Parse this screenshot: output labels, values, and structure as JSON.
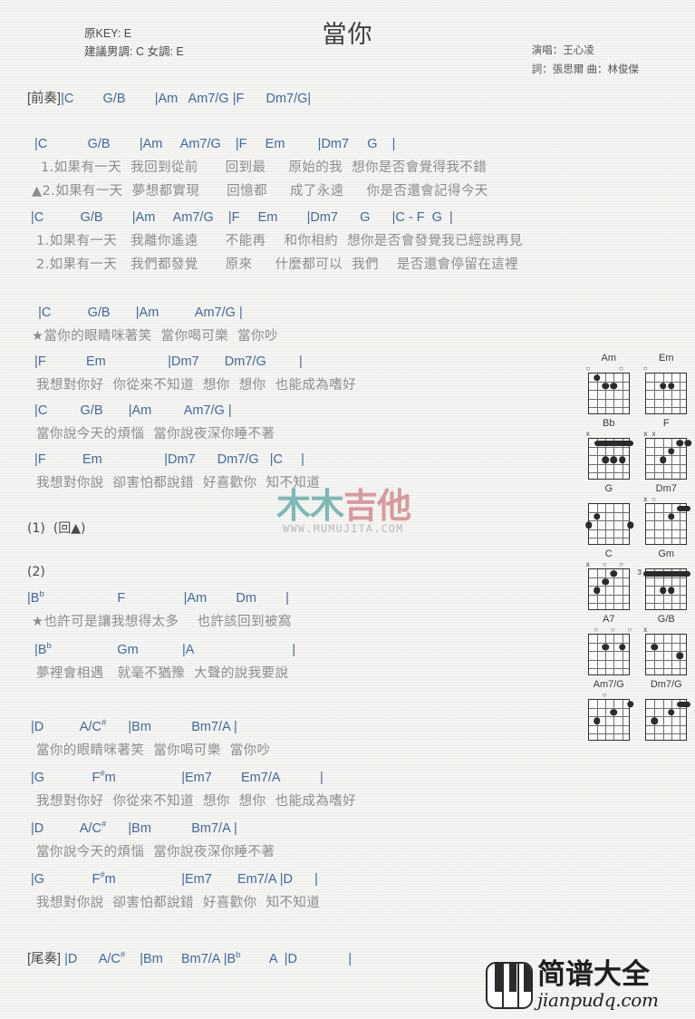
{
  "header": {
    "title": "當你",
    "orig_key": "原KEY: E",
    "suggest_key": "建議男調: C 女調: E",
    "singer": "演唱：王心凌",
    "writer": "詞：張思爾  曲：林俊傑"
  },
  "intro": {
    "tag": "[前奏]",
    "chords": "|C        G/B        |Am   Am7/G |F      Dm7/G|"
  },
  "verse1": {
    "chord_line_1": "  |C           G/B        |Am     Am7/G    |F     Em         |Dm7     G    |",
    "lyric_1": "   1.如果有一天  我回到從前      回到最     原始的我  想你是否會覺得我不錯",
    "lyric_2": " ▲2.如果有一天  夢想都實現      回憶都     成了永遠     你是否還會記得今天",
    "chord_line_2": " |C          G/B        |Am     Am7/G    |F     Em        |Dm7      G      |C - F  G  |",
    "lyric_3": "  1.如果有一天   我離你遙遠      不能再    和你相約  想你是否會發覺我已經說再見",
    "lyric_4": "  2.如果有一天   我們都發覺      原來     什麼都可以  我們    是否還會停留在這裡"
  },
  "chorus_c": {
    "chord_line_1": "   |C          G/B       |Am          Am7/G |",
    "lyric_1": " ★當你的眼睛咪著笑  當你喝可樂  當你吵",
    "chord_line_2": "  |F           Em                 |Dm7       Dm7/G         |",
    "lyric_2": "  我想對你好  你從來不知道  想你  想你  也能成為嗜好",
    "chord_line_3": "  |C         G/B       |Am         Am7/G |",
    "lyric_3": "  當你說今天的煩惱  當你說夜深你睡不著",
    "chord_line_4": "  |F          Em                 |Dm7      Dm7/G   |C     |",
    "lyric_4": "  我想對你說  卻害怕都說錯  好喜歡你  知不知道"
  },
  "section_1": {
    "label": "(1)  (回▲)"
  },
  "section_2": {
    "label": "(2)"
  },
  "bridge": {
    "chord_line_1_a": "|B",
    "chord_line_1_sup": "b",
    "chord_line_1_b": "                    F                |Am        Dm        |",
    "lyric_1": " ★也許可是讓我想得太多    也許該回到被窩",
    "chord_line_2_a": "  |B",
    "chord_line_2_sup": "b",
    "chord_line_2_b": "                  Gm            |A                           |",
    "lyric_2": "  夢裡會相遇   就毫不猶豫  大聲的說我要說"
  },
  "chorus_d": {
    "c1_a": " |D          A/C",
    "c1_sup": "#",
    "c1_b": "      |Bm           Bm7/A |",
    "l1": "  當你的眼睛咪著笑  當你喝可樂  當你吵",
    "c2_a": " |G             F",
    "c2_sup": "#",
    "c2_b": "m                  |Em7        Em7/A           |",
    "l2": "  我想對你好  你從來不知道  想你  想你  也能成為嗜好",
    "c3_a": " |D          A/C",
    "c3_sup": "#",
    "c3_b": "      |Bm           Bm7/A |",
    "l3": "  當你說今天的煩惱  當你說夜深你睡不著",
    "c4_a": " |G             F",
    "c4_sup": "#",
    "c4_b": "m                  |Em7       Em7/A |D      |",
    "l4": "  我想對你說  卻害怕都說錯  好喜歡你  知不知道"
  },
  "outro": {
    "tag": "[尾奏]",
    "c_a": " |D      A/C",
    "c_sup": "#",
    "c_b": "    |Bm     Bm7/A |B",
    "c_sup2": "b",
    "c_c": "        A  |D              |"
  },
  "watermark_mumujita": {
    "logo_part1": "木木",
    "logo_part2": "吉他",
    "url": "WWW.MUMUJITA.COM",
    "color1": "#7fb7b5",
    "color2": "#d79a9c"
  },
  "logo_jianpudq": {
    "cn": "简谱大全",
    "en": "jianpudq.com"
  },
  "chord_diagrams": [
    {
      "name": "Am",
      "markers": [
        {
          "sym": "o",
          "string": 1
        },
        {
          "sym": "o",
          "string": 5
        }
      ],
      "dots": [
        {
          "s": 2,
          "f": 1
        },
        {
          "s": 3,
          "f": 2
        },
        {
          "s": 4,
          "f": 2
        }
      ],
      "barre": null,
      "fret_label": ""
    },
    {
      "name": "Em",
      "markers": [
        {
          "sym": "o",
          "string": 1
        }
      ],
      "dots": [
        {
          "s": 3,
          "f": 2
        },
        {
          "s": 4,
          "f": 2
        }
      ],
      "barre": null,
      "fret_label": ""
    },
    {
      "name": "Bb",
      "markers": [
        {
          "sym": "x",
          "string": 1
        }
      ],
      "dots": [
        {
          "s": 3,
          "f": 3
        },
        {
          "s": 4,
          "f": 3
        },
        {
          "s": 5,
          "f": 3
        }
      ],
      "barre": {
        "f": 1,
        "from": 2,
        "to": 6
      },
      "fret_label": ""
    },
    {
      "name": "F",
      "markers": [
        {
          "sym": "x",
          "string": 1
        },
        {
          "sym": "x",
          "string": 2
        }
      ],
      "dots": [
        {
          "s": 3,
          "f": 3
        },
        {
          "s": 4,
          "f": 2
        },
        {
          "s": 5,
          "f": 1
        },
        {
          "s": 6,
          "f": 1
        }
      ],
      "barre": null,
      "fret_label": ""
    },
    {
      "name": "G",
      "markers": [],
      "dots": [
        {
          "s": 1,
          "f": 3
        },
        {
          "s": 2,
          "f": 2
        },
        {
          "s": 6,
          "f": 3
        }
      ],
      "barre": null,
      "fret_label": ""
    },
    {
      "name": "Dm7",
      "markers": [
        {
          "sym": "x",
          "string": 1
        },
        {
          "sym": "o",
          "string": 2
        }
      ],
      "dots": [
        {
          "s": 4,
          "f": 2
        }
      ],
      "barre": {
        "f": 1,
        "from": 5,
        "to": 6
      },
      "fret_label": ""
    },
    {
      "name": "C",
      "markers": [
        {
          "sym": "x",
          "string": 1
        },
        {
          "sym": "o",
          "string": 3
        },
        {
          "sym": "o",
          "string": 5
        }
      ],
      "dots": [
        {
          "s": 2,
          "f": 3
        },
        {
          "s": 3,
          "f": 2
        },
        {
          "s": 4,
          "f": 1
        }
      ],
      "barre": null,
      "fret_label": ""
    },
    {
      "name": "Gm",
      "markers": [],
      "dots": [
        {
          "s": 3,
          "f": 3
        },
        {
          "s": 4,
          "f": 3
        }
      ],
      "barre": {
        "f": 1,
        "from": 1,
        "to": 6
      },
      "fret_label": "3"
    },
    {
      "name": "A7",
      "markers": [
        {
          "sym": "o",
          "string": 2
        },
        {
          "sym": "o",
          "string": 4
        },
        {
          "sym": "o",
          "string": 6
        }
      ],
      "dots": [
        {
          "s": 3,
          "f": 2
        },
        {
          "s": 5,
          "f": 2
        }
      ],
      "barre": null,
      "fret_label": ""
    },
    {
      "name": "G/B",
      "markers": [
        {
          "sym": "x",
          "string": 1
        }
      ],
      "dots": [
        {
          "s": 2,
          "f": 2
        },
        {
          "s": 5,
          "f": 3
        }
      ],
      "barre": null,
      "fret_label": ""
    },
    {
      "name": "Am7/G",
      "markers": [
        {
          "sym": "o",
          "string": 3
        }
      ],
      "dots": [
        {
          "s": 2,
          "f": 3
        },
        {
          "s": 4,
          "f": 2
        },
        {
          "s": 6,
          "f": 1
        }
      ],
      "barre": null,
      "fret_label": ""
    },
    {
      "name": "Dm7/G",
      "markers": [],
      "dots": [
        {
          "s": 2,
          "f": 3
        },
        {
          "s": 4,
          "f": 2
        }
      ],
      "barre": {
        "f": 1,
        "from": 5,
        "to": 6
      },
      "fret_label": ""
    }
  ]
}
